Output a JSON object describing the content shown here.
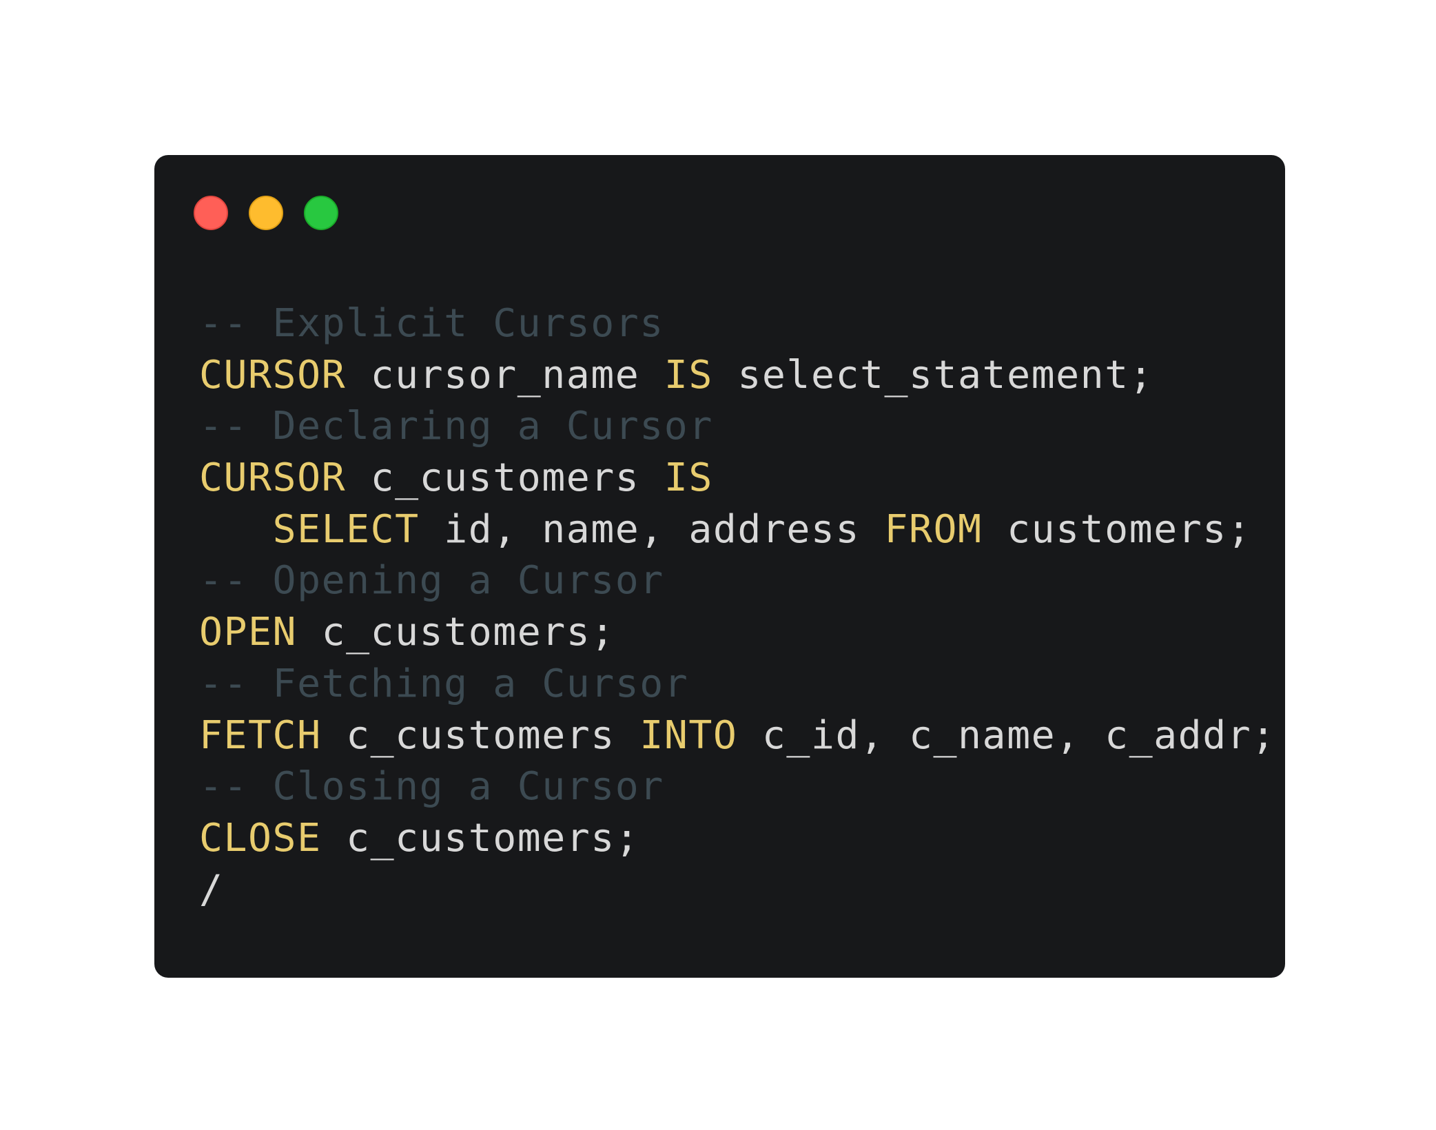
{
  "colors": {
    "page_background": "#ffffff",
    "window_background": "#17181a",
    "close_dot": "#ff5f57",
    "minimize_dot": "#febc2e",
    "zoom_dot": "#28c840",
    "comment": "#3c4a52",
    "keyword": "#e8cc6e",
    "plain": "#d8d8d8"
  },
  "window_controls": [
    "close-dot",
    "minimize-dot",
    "zoom-dot"
  ],
  "code": {
    "language": "PL/SQL",
    "lines": [
      [
        {
          "t": "comment",
          "v": "-- Explicit Cursors"
        }
      ],
      [
        {
          "t": "keyword",
          "v": "CURSOR"
        },
        {
          "t": "plain",
          "v": " cursor_name "
        },
        {
          "t": "keyword",
          "v": "IS"
        },
        {
          "t": "plain",
          "v": " select_statement;"
        }
      ],
      [
        {
          "t": "comment",
          "v": "-- Declaring a Cursor"
        }
      ],
      [
        {
          "t": "keyword",
          "v": "CURSOR"
        },
        {
          "t": "plain",
          "v": " c_customers "
        },
        {
          "t": "keyword",
          "v": "IS"
        }
      ],
      [
        {
          "t": "plain",
          "v": "   "
        },
        {
          "t": "keyword",
          "v": "SELECT"
        },
        {
          "t": "plain",
          "v": " id, name, address "
        },
        {
          "t": "keyword",
          "v": "FROM"
        },
        {
          "t": "plain",
          "v": " customers;"
        }
      ],
      [
        {
          "t": "comment",
          "v": "-- Opening a Cursor"
        }
      ],
      [
        {
          "t": "keyword",
          "v": "OPEN"
        },
        {
          "t": "plain",
          "v": " c_customers;"
        }
      ],
      [
        {
          "t": "comment",
          "v": "-- Fetching a Cursor"
        }
      ],
      [
        {
          "t": "keyword",
          "v": "FETCH"
        },
        {
          "t": "plain",
          "v": " c_customers "
        },
        {
          "t": "keyword",
          "v": "INTO"
        },
        {
          "t": "plain",
          "v": " c_id, c_name, c_addr;"
        }
      ],
      [
        {
          "t": "comment",
          "v": "-- Closing a Cursor"
        }
      ],
      [
        {
          "t": "keyword",
          "v": "CLOSE"
        },
        {
          "t": "plain",
          "v": " c_customers;"
        }
      ],
      [
        {
          "t": "plain",
          "v": "/"
        }
      ]
    ]
  }
}
